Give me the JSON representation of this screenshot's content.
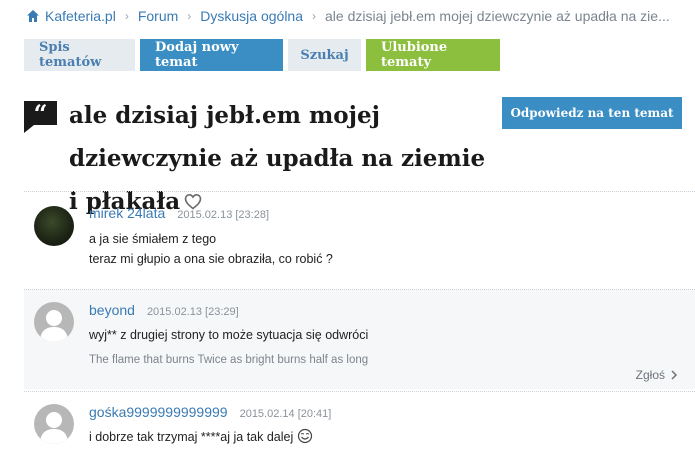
{
  "breadcrumb": {
    "items": [
      "Kafeteria.pl",
      "Forum",
      "Dyskusja ogólna",
      "ale dzisiaj jebł.em mojej dziewczynie aż upadła na zie..."
    ]
  },
  "tabs": {
    "list": "Spis tematów",
    "new_topic": "Dodaj nowy temat",
    "search": "Szukaj",
    "favorites": "Ulubione tematy"
  },
  "topic": {
    "title": "ale dzisiaj jebł.em mojej dziewczynie aż upadła na ziemie i płakała",
    "reply_button": "Odpowiedz na ten temat"
  },
  "posts": [
    {
      "author": "mirek 24lata",
      "date": "2015.02.13 [23:28]",
      "lines": [
        "a ja sie śmiałem z tego",
        "teraz mi głupio a ona sie obraziła, co robić ?"
      ]
    },
    {
      "author": "beyond",
      "date": "2015.02.13 [23:29]",
      "lines": [
        "wyj** z drugiej strony to może sytuacja się odwróci"
      ],
      "signature": "The flame that burns Twice as bright burns half as long",
      "report": "Zgłoś"
    },
    {
      "author": "gośka9999999999999",
      "date": "2015.02.14 [20:41]",
      "lines": [
        "i dobrze tak trzymaj ****aj ja tak dalej"
      ]
    }
  ],
  "colors": {
    "link": "#3a7bb5",
    "primary_button": "#3b8ec4",
    "favorites_button": "#8dbf3e",
    "tab_background": "#e6ebf0"
  },
  "icons": [
    "home-icon",
    "quote-icon",
    "heart-icon",
    "chevron-right-icon",
    "smiley-icon"
  ]
}
